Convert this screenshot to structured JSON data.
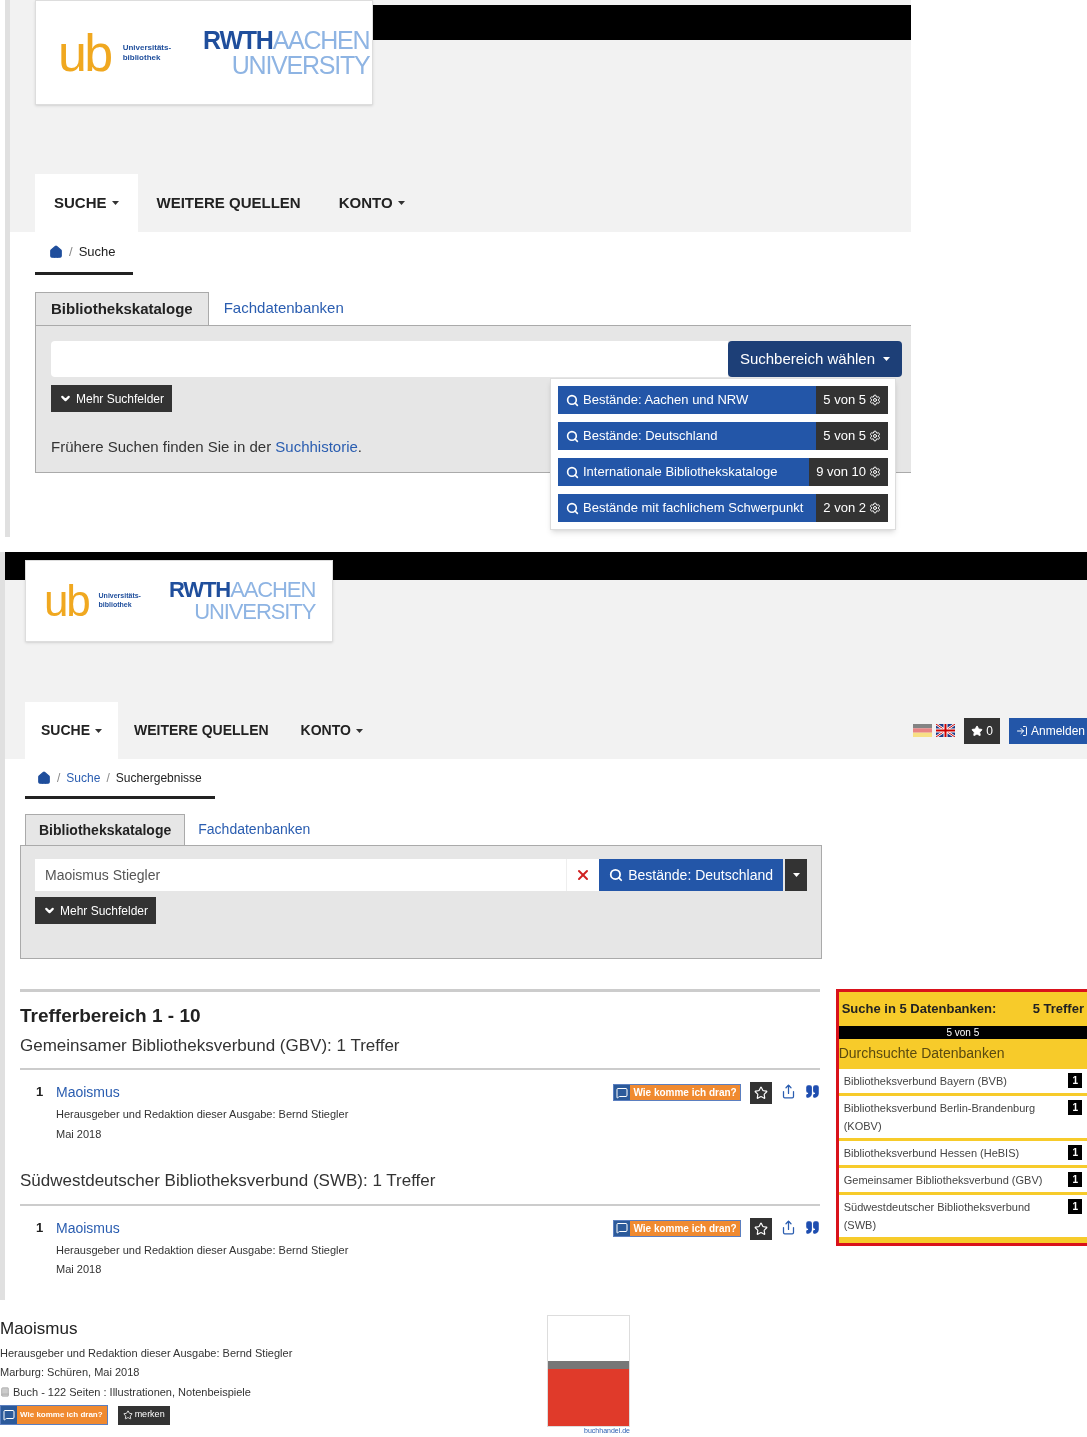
{
  "search_page": {
    "logo": {
      "ub": "ub",
      "ub_sub": [
        "Universitäts-",
        "bibliothek"
      ],
      "rwth": "RWTH",
      "aachen": "AACHEN",
      "university": "UNIVERSITY"
    },
    "nav": [
      {
        "label": "SUCHE",
        "caret": true,
        "selected": true
      },
      {
        "label": "WEITERE QUELLEN",
        "caret": false,
        "selected": false
      },
      {
        "label": "KONTO",
        "caret": true,
        "selected": false
      }
    ],
    "breadcrumb": [
      {
        "separator": "/",
        "label": "Suche"
      }
    ],
    "tabs": [
      {
        "label": "Bibliothekskataloge",
        "selected": true
      },
      {
        "label": "Fachdatenbanken",
        "selected": false
      }
    ],
    "search": {
      "button": "Suchbereich wählen"
    },
    "more_fields": "Mehr Suchfelder",
    "history": {
      "text": "Frühere Suchen finden Sie in der ",
      "link": "Suchhistorie",
      "end": "."
    },
    "scope_menu": [
      {
        "label": "Bestände: Aachen und NRW",
        "count": "5 von 5"
      },
      {
        "label": "Bestände: Deutschland",
        "count": "5 von 5"
      },
      {
        "label": "Internationale Bibliothekskataloge",
        "count": "9 von 10"
      },
      {
        "label": "Bestände mit fachlichem Schwerpunkt",
        "count": "2 von 2"
      }
    ]
  },
  "results_page": {
    "logo": {
      "ub": "ub",
      "ub_sub": [
        "Universitäts-",
        "bibliothek"
      ],
      "rwth": "RWTH",
      "aachen": "AACHEN",
      "university": "UNIVERSITY"
    },
    "nav": [
      {
        "label": "SUCHE",
        "caret": true,
        "selected": true
      },
      {
        "label": "WEITERE QUELLEN",
        "caret": false,
        "selected": false
      },
      {
        "label": "KONTO",
        "caret": true,
        "selected": false
      }
    ],
    "watchlist_count": "0",
    "login": "Anmelden",
    "breadcrumb": [
      {
        "separator": "/",
        "label": "Suche"
      },
      {
        "separator": "/",
        "label": "Suchergebnisse"
      }
    ],
    "tabs": [
      {
        "label": "Bibliothekskataloge",
        "selected": true
      },
      {
        "label": "Fachdatenbanken",
        "selected": false
      }
    ],
    "search": {
      "value": "Maoismus Stiegler",
      "button": "Bestände: Deutschland"
    },
    "more_fields": "Mehr Suchfelder",
    "results_heading": "Trefferbereich 1 - 10",
    "groups": [
      {
        "heading": "Gemeinsamer Bibliotheksverbund (GBV): 1 Treffer",
        "hits": [
          {
            "number": "1",
            "title": "Maoismus",
            "author": "Herausgeber und Redaktion dieser Ausgabe: Bernd Stiegler",
            "date": "Mai 2018",
            "access": "Wie komme ich dran?"
          }
        ]
      },
      {
        "heading": "Südwestdeutscher Bibliotheksverbund (SWB): 1 Treffer",
        "hits": [
          {
            "number": "1",
            "title": "Maoismus",
            "author": "Herausgeber und Redaktion dieser Ausgabe: Bernd Stiegler",
            "date": "Mai 2018",
            "access": "Wie komme ich dran?"
          }
        ]
      }
    ],
    "sidebar": {
      "title": "Suche in 5 Datenbanken:",
      "total": "5 Treffer",
      "progress": {
        "label": "5 von 5",
        "level": 1
      },
      "subtitle": "Durchsuchte Datenbanken",
      "databases": [
        {
          "name": "Bibliotheksverbund Bayern (BVB)",
          "count": "1"
        },
        {
          "name": "Bibliotheksverbund Berlin-Brandenburg (KOBV)",
          "count": "1"
        },
        {
          "name": "Bibliotheksverbund Hessen (HeBIS)",
          "count": "1"
        },
        {
          "name": "Gemeinsamer Bibliotheksverbund (GBV)",
          "count": "1"
        },
        {
          "name": "Südwestdeutscher Bibliotheksverbund (SWB)",
          "count": "1"
        }
      ]
    }
  },
  "detail": {
    "title": "Maoismus",
    "lines": [
      "Herausgeber und Redaktion dieser Ausgabe: Bernd Stiegler",
      "Marburg: Schüren, Mai 2018"
    ],
    "format_line": "Buch - 122 Seiten : Illustrationen, Notenbeispiele",
    "access": "Wie komme ich dran?",
    "bookmark": "merken",
    "cover_link": "buchhandel.de"
  }
}
